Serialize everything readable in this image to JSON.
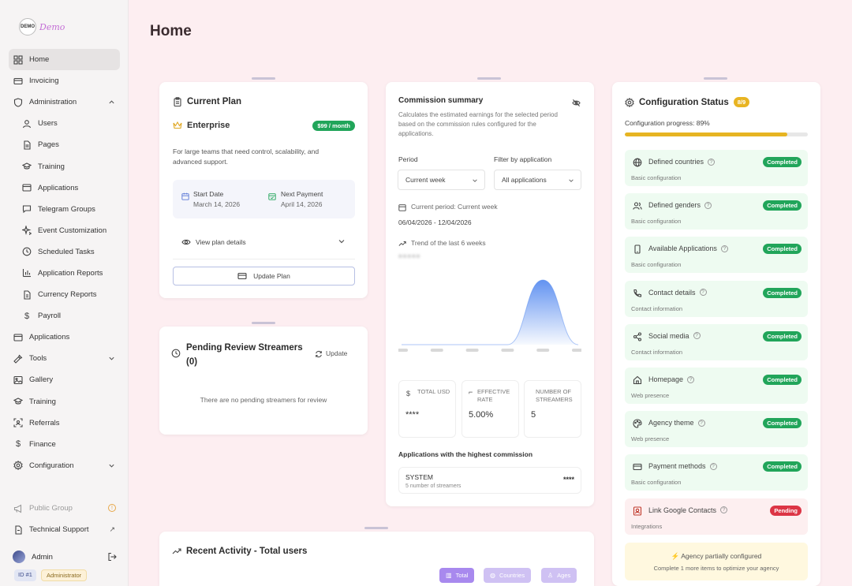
{
  "app": {
    "logo_text": "Demo",
    "logo_badge": "DEMO"
  },
  "sidebar": {
    "items": [
      {
        "label": "Home",
        "icon": "grid-icon"
      },
      {
        "label": "Invoicing",
        "icon": "card-icon"
      },
      {
        "label": "Administration",
        "icon": "shield-icon"
      },
      {
        "label": "Users",
        "icon": "user-icon"
      },
      {
        "label": "Pages",
        "icon": "page-icon"
      },
      {
        "label": "Training",
        "icon": "graduation-icon"
      },
      {
        "label": "Applications",
        "icon": "window-icon"
      },
      {
        "label": "Telegram Groups",
        "icon": "chat-icon"
      },
      {
        "label": "Event Customization",
        "icon": "sparkle-icon"
      },
      {
        "label": "Scheduled Tasks",
        "icon": "clock-icon"
      },
      {
        "label": "Application Reports",
        "icon": "bar-chart-icon"
      },
      {
        "label": "Currency Reports",
        "icon": "report-icon"
      },
      {
        "label": "Payroll",
        "icon": "dollar-icon"
      },
      {
        "label": "Applications",
        "icon": "window-icon"
      },
      {
        "label": "Tools",
        "icon": "wrench-icon"
      },
      {
        "label": "Gallery",
        "icon": "image-icon"
      },
      {
        "label": "Training",
        "icon": "graduation-icon"
      },
      {
        "label": "Referrals",
        "icon": "referral-icon"
      },
      {
        "label": "Finance",
        "icon": "dollar-icon"
      },
      {
        "label": "Configuration",
        "icon": "gear-icon"
      }
    ],
    "public_group": "Public Group",
    "technical_support": "Technical Support",
    "user_name": "Admin",
    "user_id": "ID #1",
    "user_role": "Administrator"
  },
  "page": {
    "title": "Home"
  },
  "plan": {
    "title": "Current Plan",
    "name": "Enterprise",
    "price": "$99 / month",
    "description": "For large teams that need control, scalability, and advanced support.",
    "start_label": "Start Date",
    "start_value": "March 14, 2026",
    "next_label": "Next Payment",
    "next_value": "April 14, 2026",
    "view_details": "View plan details",
    "update_button": "Update Plan"
  },
  "pending": {
    "title": "Pending Review Streamers",
    "count": "(0)",
    "update": "Update",
    "empty": "There are no pending streamers for review"
  },
  "commission": {
    "title": "Commission summary",
    "description": "Calculates the estimated earnings for the selected period based on the commission rules configured for the applications.",
    "period_label": "Period",
    "period_value": "Current week",
    "filter_label": "Filter by application",
    "filter_value": "All applications",
    "current_period": "Current period: Current week",
    "date_range": "06/04/2026 - 12/04/2026",
    "trend_label": "Trend of the last 6 weeks",
    "hidden_value": "*****",
    "stats": [
      {
        "label": "TOTAL USD",
        "value": "****"
      },
      {
        "label": "EFFECTIVE RATE",
        "value": "5.00%"
      },
      {
        "label": "NUMBER OF STREAMERS",
        "value": "5"
      }
    ],
    "top_title": "Applications with the highest commission",
    "top_name": "SYSTEM",
    "top_sub": "5 number of streamers",
    "top_value": "****",
    "chart_data": {
      "type": "area",
      "x": [
        "",
        "",
        "",
        "",
        "",
        ""
      ],
      "values": [
        0,
        0,
        0,
        0,
        1,
        0
      ],
      "title": "",
      "xlabel": "",
      "ylabel": "",
      "grid": false,
      "color": "#5a8df0"
    }
  },
  "config": {
    "title": "Configuration Status",
    "count": "8/9",
    "progress_label": "Configuration progress: 89%",
    "progress": 0.89,
    "items": [
      {
        "title": "Defined countries",
        "sub": "Basic configuration",
        "status": "Completed",
        "icon": "globe-icon"
      },
      {
        "title": "Defined genders",
        "sub": "Basic configuration",
        "status": "Completed",
        "icon": "users-icon"
      },
      {
        "title": "Available Applications",
        "sub": "Basic configuration",
        "status": "Completed",
        "icon": "phone-icon"
      },
      {
        "title": "Contact details",
        "sub": "Contact information",
        "status": "Completed",
        "icon": "telephone-icon"
      },
      {
        "title": "Social media",
        "sub": "Contact information",
        "status": "Completed",
        "icon": "share-icon"
      },
      {
        "title": "Homepage",
        "sub": "Web presence",
        "status": "Completed",
        "icon": "home-icon"
      },
      {
        "title": "Agency theme",
        "sub": "Web presence",
        "status": "Completed",
        "icon": "palette-icon"
      },
      {
        "title": "Payment methods",
        "sub": "Basic configuration",
        "status": "Completed",
        "icon": "card-icon"
      },
      {
        "title": "Link Google Contacts",
        "sub": "Integrations",
        "status": "Pending",
        "icon": "contact-icon"
      }
    ],
    "partial_title": "Agency partially configured",
    "partial_sub": "Complete 1 more items to optimize your agency"
  },
  "activity": {
    "title": "Recent Activity - Total users",
    "tabs": [
      "Total",
      "Countries",
      "Ages"
    ]
  },
  "colors": {
    "accent": "#21a55a",
    "pending": "#dc3545",
    "progress": "#e6b422",
    "tab_active": "#b89bf0"
  }
}
